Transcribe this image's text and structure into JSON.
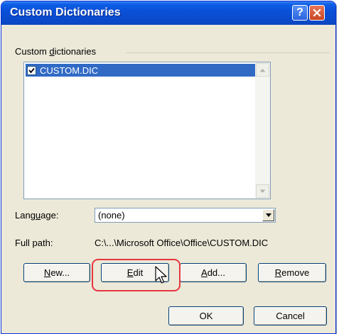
{
  "window": {
    "title": "Custom Dictionaries",
    "help_glyph": "?",
    "close_icon": "close-icon"
  },
  "group": {
    "label_pre": "Custom ",
    "label_accel": "d",
    "label_post": "ictionaries"
  },
  "dictionaries": [
    {
      "name": "CUSTOM.DIC",
      "checked": true,
      "selected": true
    }
  ],
  "language": {
    "label_pre": "Lang",
    "label_accel": "u",
    "label_post": "age:",
    "value": "(none)"
  },
  "full_path": {
    "label": "Full path:",
    "value": "C:\\...\\Microsoft Office\\Office\\CUSTOM.DIC"
  },
  "buttons": {
    "new": {
      "accel": "N",
      "rest": "ew..."
    },
    "edit": {
      "accel": "E",
      "rest": "dit"
    },
    "add": {
      "accel": "A",
      "rest": "dd..."
    },
    "remove": {
      "accel": "R",
      "rest": "emove"
    },
    "ok": "OK",
    "cancel": "Cancel"
  },
  "colors": {
    "title_bar": "#0A50D8",
    "selection": "#316AC5",
    "annotation": "#E5363F"
  }
}
